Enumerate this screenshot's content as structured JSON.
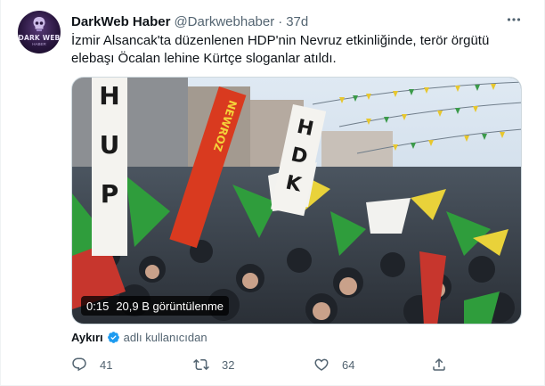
{
  "account": {
    "avatar_text": "DARK WEB",
    "avatar_subtext": "HABER",
    "name": "DarkWeb Haber",
    "handle": "@Darkwebhaber",
    "separator": "·",
    "timestamp": "37d"
  },
  "more_icon": "more-horizontal-icon",
  "tweet": {
    "line1": "İzmir Alsancak'ta düzenlenen HDP'nin Nevruz etkinliğinde, terör örgütü",
    "line2": "elebaşı Öcalan lehine Kürtçe sloganlar atıldı."
  },
  "media": {
    "duration": "0:15",
    "views": "20,9 B görüntülenme",
    "banner_left": "HDP",
    "banner_right": "HDK",
    "flag_text": "NEWROZ"
  },
  "attribution": {
    "source": "Aykırı",
    "verified_icon": "verified-badge-icon",
    "suffix": "adlı kullanıcıdan"
  },
  "actions": {
    "reply_count": "41",
    "retweet_count": "32",
    "like_count": "64",
    "reply_icon": "reply-icon",
    "retweet_icon": "retweet-icon",
    "like_icon": "heart-icon",
    "share_icon": "share-icon"
  },
  "colors": {
    "text_primary": "#0f1419",
    "text_secondary": "#536471",
    "verified": "#1d9bf0",
    "border": "#cfd9de"
  }
}
